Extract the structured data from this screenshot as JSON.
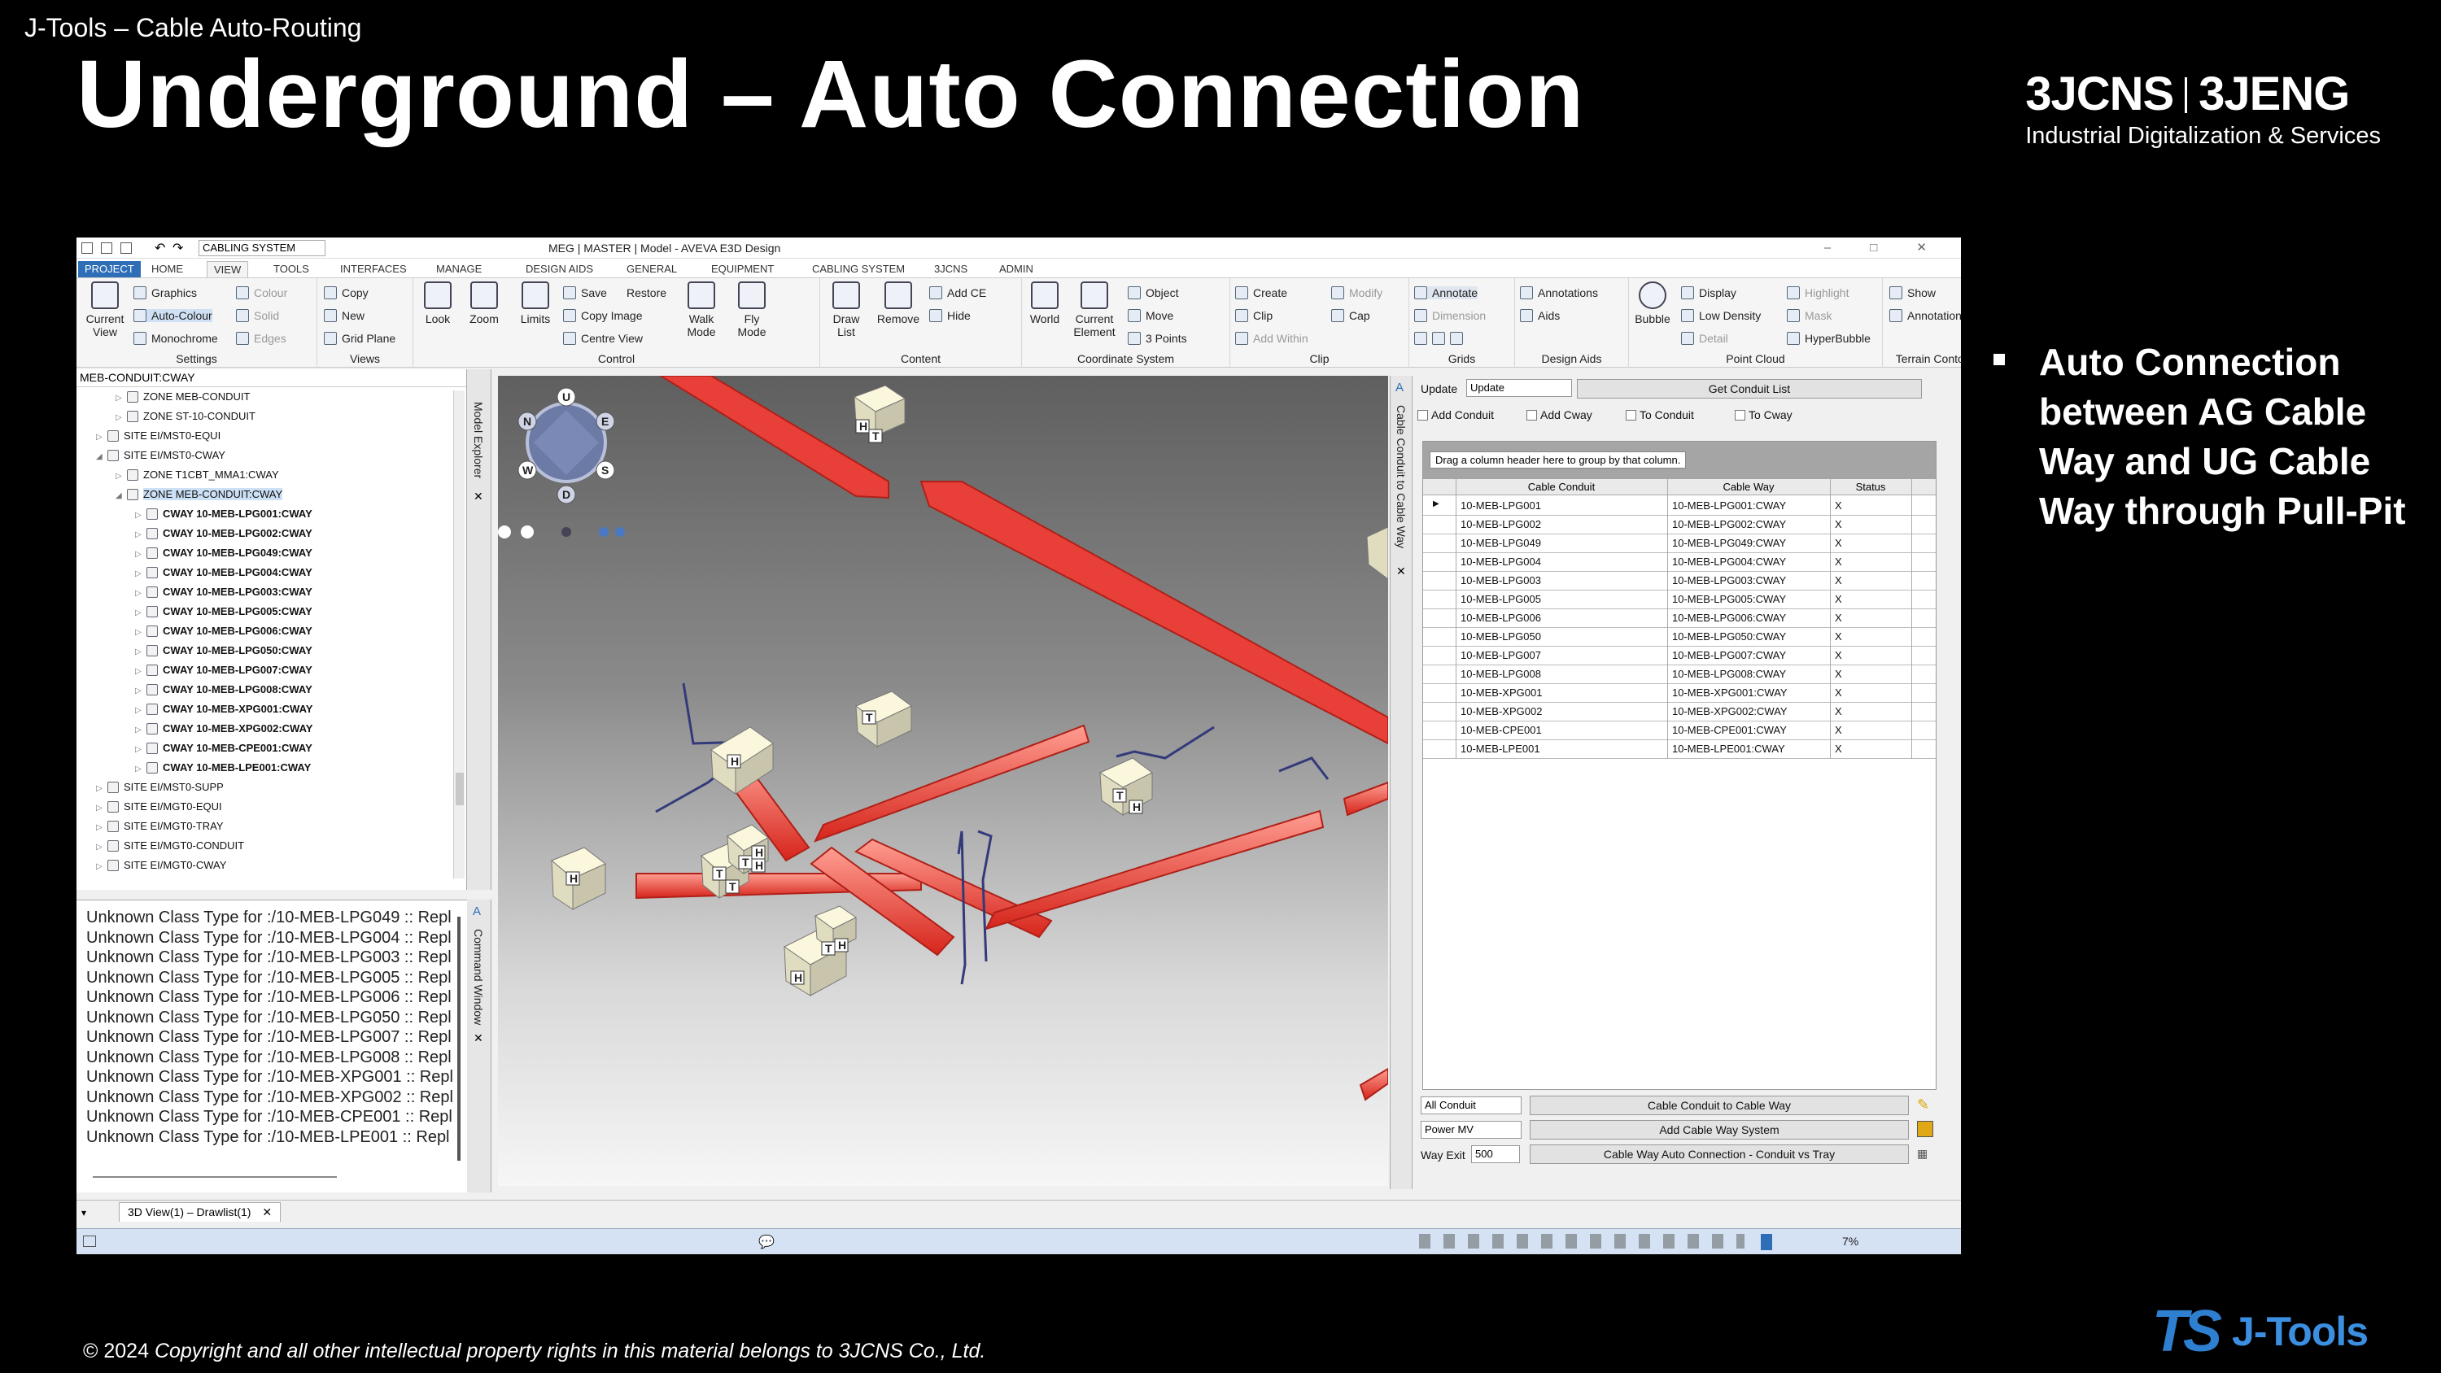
{
  "slide": {
    "topic": "J-Tools – Cable Auto-Routing",
    "title": "Underground – Auto Connection",
    "brand_left": "3JCNS",
    "brand_right": "3JENG",
    "brand_sub": "Industrial Digitalization & Services",
    "bullet": "Auto Connection between AG Cable Way and UG Cable Way through Pull-Pit",
    "footer_symbol": "© 2024",
    "footer_text": "Copyright and all other intellectual property rights in this material belongs to 3JCNS Co., Ltd.",
    "logo_ts": "TS",
    "logo_jtools": "J-Tools"
  },
  "app": {
    "qat_combo": "CABLING SYSTEM",
    "window_title": "MEG | MASTER | Model - AVEVA E3D Design",
    "window_controls": "– □ ✕",
    "tabs": [
      "PROJECT",
      "HOME",
      "VIEW",
      "TOOLS",
      "INTERFACES",
      "MANAGE",
      "DESIGN AIDS",
      "GENERAL",
      "EQUIPMENT",
      "CABLING SYSTEM",
      "3JCNS",
      "ADMIN"
    ],
    "selected_tab": "VIEW",
    "ribbon": {
      "settings": {
        "label": "Settings",
        "current_view": "Current View",
        "graphics": "Graphics",
        "auto_colour": "Auto-Colour",
        "monochrome": "Monochrome",
        "colour": "Colour",
        "solid": "Solid",
        "edges": "Edges"
      },
      "views": {
        "label": "Views",
        "copy": "Copy",
        "new": "New",
        "grid_plane": "Grid Plane"
      },
      "control": {
        "label": "Control",
        "look": "Look",
        "zoom": "Zoom",
        "limits": "Limits",
        "save": "Save",
        "restore": "Restore",
        "copy_image": "Copy Image",
        "centre_view": "Centre View",
        "walk_mode": "Walk Mode",
        "fly_mode": "Fly Mode"
      },
      "content": {
        "label": "Content",
        "draw_list": "Draw List",
        "remove": "Remove",
        "add_ce": "Add CE",
        "hide": "Hide"
      },
      "coordinate": {
        "label": "Coordinate System",
        "world": "World",
        "current_element": "Current Element",
        "object": "Object",
        "move": "Move",
        "three_points": "3 Points"
      },
      "clip": {
        "label": "Clip",
        "create": "Create",
        "clip": "Clip",
        "add_within": "Add Within",
        "modify": "Modify",
        "cap": "Cap"
      },
      "grids": {
        "label": "Grids",
        "annotate": "Annotate",
        "dimension": "Dimension"
      },
      "design_aids": {
        "label": "Design Aids",
        "annotations": "Annotations",
        "aids": "Aids"
      },
      "point_cloud": {
        "label": "Point Cloud",
        "bubble": "Bubble",
        "display": "Display",
        "low_density": "Low Density",
        "detail": "Detail",
        "highlight": "Highlight",
        "mask": "Mask",
        "hyperbubble": "HyperBubble"
      },
      "terrain": {
        "label": "Terrain Contours",
        "show": "Show",
        "annotations": "Annotations"
      }
    },
    "explorer": {
      "header": "MEB-CONDUIT:CWAY",
      "side_label": "Model Explorer",
      "rows": [
        {
          "text": "ZONE MEB-CONDUIT",
          "indent": 2,
          "bold": false,
          "sel": false
        },
        {
          "text": "ZONE ST-10-CONDUIT",
          "indent": 2,
          "bold": false,
          "sel": false
        },
        {
          "text": "SITE EI/MST0-EQUI",
          "indent": 1,
          "bold": false,
          "sel": false
        },
        {
          "text": "SITE EI/MST0-CWAY",
          "indent": 1,
          "bold": false,
          "sel": false
        },
        {
          "text": "ZONE T1CBT_MMA1:CWAY",
          "indent": 2,
          "bold": false,
          "sel": false
        },
        {
          "text": "ZONE MEB-CONDUIT:CWAY",
          "indent": 2,
          "bold": false,
          "sel": true
        },
        {
          "text": "CWAY 10-MEB-LPG001:CWAY",
          "indent": 3,
          "bold": true,
          "sel": false
        },
        {
          "text": "CWAY 10-MEB-LPG002:CWAY",
          "indent": 3,
          "bold": true,
          "sel": false
        },
        {
          "text": "CWAY 10-MEB-LPG049:CWAY",
          "indent": 3,
          "bold": true,
          "sel": false
        },
        {
          "text": "CWAY 10-MEB-LPG004:CWAY",
          "indent": 3,
          "bold": true,
          "sel": false
        },
        {
          "text": "CWAY 10-MEB-LPG003:CWAY",
          "indent": 3,
          "bold": true,
          "sel": false
        },
        {
          "text": "CWAY 10-MEB-LPG005:CWAY",
          "indent": 3,
          "bold": true,
          "sel": false
        },
        {
          "text": "CWAY 10-MEB-LPG006:CWAY",
          "indent": 3,
          "bold": true,
          "sel": false
        },
        {
          "text": "CWAY 10-MEB-LPG050:CWAY",
          "indent": 3,
          "bold": true,
          "sel": false
        },
        {
          "text": "CWAY 10-MEB-LPG007:CWAY",
          "indent": 3,
          "bold": true,
          "sel": false
        },
        {
          "text": "CWAY 10-MEB-LPG008:CWAY",
          "indent": 3,
          "bold": true,
          "sel": false
        },
        {
          "text": "CWAY 10-MEB-XPG001:CWAY",
          "indent": 3,
          "bold": true,
          "sel": false
        },
        {
          "text": "CWAY 10-MEB-XPG002:CWAY",
          "indent": 3,
          "bold": true,
          "sel": false
        },
        {
          "text": "CWAY 10-MEB-CPE001:CWAY",
          "indent": 3,
          "bold": true,
          "sel": false
        },
        {
          "text": "CWAY 10-MEB-LPE001:CWAY",
          "indent": 3,
          "bold": true,
          "sel": false
        },
        {
          "text": "SITE EI/MST0-SUPP",
          "indent": 1,
          "bold": false,
          "sel": false
        },
        {
          "text": "SITE EI/MGT0-EQUI",
          "indent": 1,
          "bold": false,
          "sel": false
        },
        {
          "text": "SITE EI/MGT0-TRAY",
          "indent": 1,
          "bold": false,
          "sel": false
        },
        {
          "text": "SITE EI/MGT0-CONDUIT",
          "indent": 1,
          "bold": false,
          "sel": false
        },
        {
          "text": "SITE EI/MGT0-CWAY",
          "indent": 1,
          "bold": false,
          "sel": false
        }
      ]
    },
    "command": {
      "side_label": "Command Window",
      "lines": [
        "Unknown Class Type for  :/10-MEB-LPG049 :: Repl",
        "Unknown Class Type for  :/10-MEB-LPG004 :: Repl",
        "Unknown Class Type for  :/10-MEB-LPG003 :: Repl",
        "Unknown Class Type for  :/10-MEB-LPG005 :: Repl",
        "Unknown Class Type for  :/10-MEB-LPG006 :: Repl",
        "Unknown Class Type for  :/10-MEB-LPG050 :: Repl",
        "Unknown Class Type for  :/10-MEB-LPG007 :: Repl",
        "Unknown Class Type for  :/10-MEB-LPG008 :: Repl",
        "Unknown Class Type for  :/10-MEB-XPG001 :: Repl",
        "Unknown Class Type for  :/10-MEB-XPG002 :: Repl",
        "Unknown Class Type for  :/10-MEB-CPE001 :: Repl",
        "Unknown Class Type for  :/10-MEB-LPE001 :: Repl"
      ]
    },
    "viewcube": {
      "up": "U",
      "down": "D",
      "north": "N",
      "east": "E",
      "south": "S",
      "west": "W"
    },
    "panel": {
      "side_label": "Cable Conduit to Cable Way",
      "update_label": "Update",
      "update_value": "Update",
      "get_list": "Get Conduit List",
      "add_conduit": "Add Conduit",
      "add_cway": "Add Cway",
      "to_conduit": "To Conduit",
      "to_cway": "To Cway",
      "group_hint": "Drag a column header here to group by that column.",
      "col_conduit": "Cable Conduit",
      "col_way": "Cable Way",
      "col_status": "Status",
      "rows": [
        {
          "conduit": "10-MEB-LPG001",
          "way": "10-MEB-LPG001:CWAY",
          "status": "X"
        },
        {
          "conduit": "10-MEB-LPG002",
          "way": "10-MEB-LPG002:CWAY",
          "status": "X"
        },
        {
          "conduit": "10-MEB-LPG049",
          "way": "10-MEB-LPG049:CWAY",
          "status": "X"
        },
        {
          "conduit": "10-MEB-LPG004",
          "way": "10-MEB-LPG004:CWAY",
          "status": "X"
        },
        {
          "conduit": "10-MEB-LPG003",
          "way": "10-MEB-LPG003:CWAY",
          "status": "X"
        },
        {
          "conduit": "10-MEB-LPG005",
          "way": "10-MEB-LPG005:CWAY",
          "status": "X"
        },
        {
          "conduit": "10-MEB-LPG006",
          "way": "10-MEB-LPG006:CWAY",
          "status": "X"
        },
        {
          "conduit": "10-MEB-LPG050",
          "way": "10-MEB-LPG050:CWAY",
          "status": "X"
        },
        {
          "conduit": "10-MEB-LPG007",
          "way": "10-MEB-LPG007:CWAY",
          "status": "X"
        },
        {
          "conduit": "10-MEB-LPG008",
          "way": "10-MEB-LPG008:CWAY",
          "status": "X"
        },
        {
          "conduit": "10-MEB-XPG001",
          "way": "10-MEB-XPG001:CWAY",
          "status": "X"
        },
        {
          "conduit": "10-MEB-XPG002",
          "way": "10-MEB-XPG002:CWAY",
          "status": "X"
        },
        {
          "conduit": "10-MEB-CPE001",
          "way": "10-MEB-CPE001:CWAY",
          "status": "X"
        },
        {
          "conduit": "10-MEB-LPE001",
          "way": "10-MEB-LPE001:CWAY",
          "status": "X"
        }
      ],
      "filter1": "All Conduit",
      "filter2": "Power MV",
      "way_exit_label": "Way Exit",
      "way_exit_value": "500",
      "btn_conduit_to_way": "Cable Conduit to Cable Way",
      "btn_add_system": "Add Cable Way System",
      "btn_auto_connection": "Cable Way Auto Connection - Conduit vs Tray"
    },
    "doc_tab": "3D View(1) – Drawlist(1)",
    "doc_tab_close": "✕",
    "zoom": "7%"
  },
  "colors": {
    "accent": "#2e6eb7",
    "tray": "#e8463c",
    "tray_light": "#ff9d92",
    "pit": "#f4eec8",
    "logo_blue": "#2f7fd0"
  }
}
